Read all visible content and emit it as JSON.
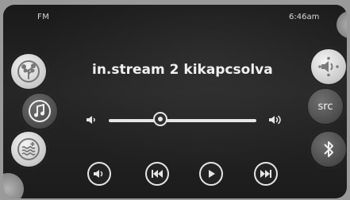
{
  "status_bar": {
    "source": "FM",
    "time": "6:46am"
  },
  "now_playing": {
    "text": "in.stream 2 kikapcsolva"
  },
  "left_menu": [
    {
      "name": "tree-icon"
    },
    {
      "name": "music-note-icon"
    },
    {
      "name": "equalizer-waves-icon"
    }
  ],
  "right_menu": {
    "speaker_icon": "speaker-icon",
    "src_label": "src",
    "bluetooth_icon": "bluetooth-icon"
  },
  "volume_slider": {
    "level": 0.35
  },
  "controls": [
    {
      "name": "volume-icon"
    },
    {
      "name": "previous-track-icon"
    },
    {
      "name": "play-icon"
    },
    {
      "name": "next-track-icon"
    }
  ],
  "colors": {
    "screen_bg": "#202020",
    "text": "#f0f0f0",
    "button_light": "#e0e0e0",
    "button_dark": "#4a4a4a"
  }
}
